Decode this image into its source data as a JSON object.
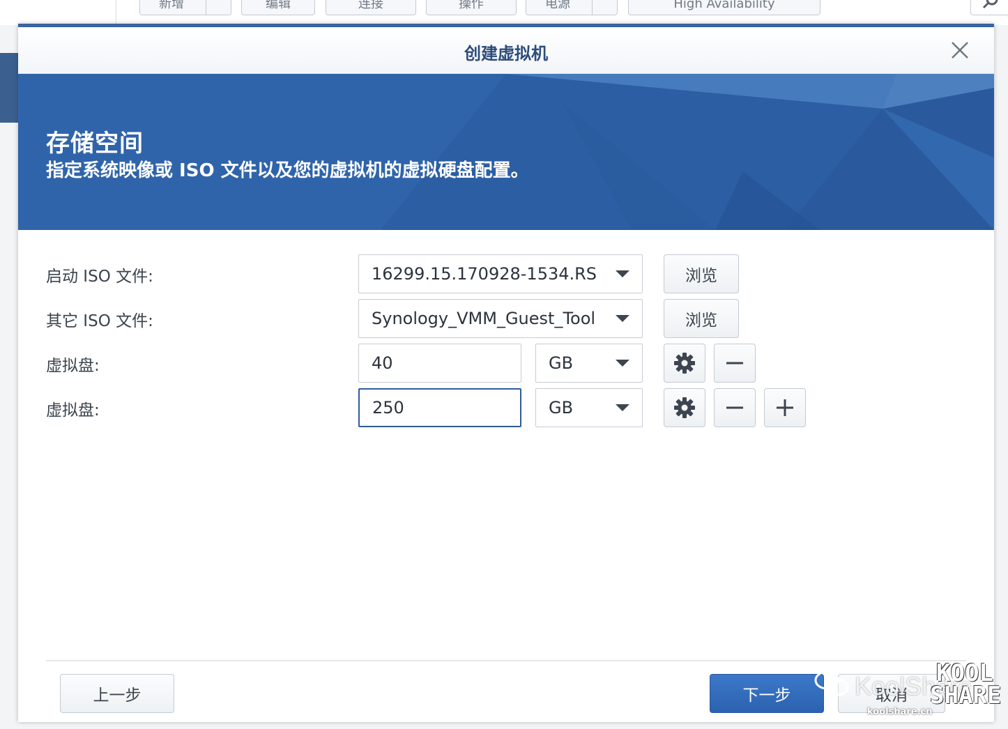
{
  "background_toolbar": {
    "buttons": [
      "新增",
      "编辑",
      "连接",
      "操作",
      "电源",
      "High Availability"
    ]
  },
  "dialog": {
    "title": "创建虚拟机",
    "banner": {
      "heading": "存储空间",
      "description": "指定系统映像或 ISO 文件以及您的虚拟机的虚拟硬盘配置。"
    },
    "form": {
      "boot_iso": {
        "label": "启动 ISO 文件:",
        "value": "16299.15.170928-1534.RS",
        "browse_label": "浏览"
      },
      "other_iso": {
        "label": "其它 ISO 文件:",
        "value": "Synology_VMM_Guest_Tool",
        "browse_label": "浏览"
      },
      "disks": [
        {
          "label": "虚拟盘:",
          "size": "40",
          "unit": "GB"
        },
        {
          "label": "虚拟盘:",
          "size": "250",
          "unit": "GB"
        }
      ]
    },
    "footer": {
      "back_label": "上一步",
      "next_label": "下一步",
      "cancel_label": "取消"
    }
  },
  "watermark": {
    "brand": "KoolShare",
    "url": "koolshare.cn",
    "logo_text": "KOOL SHARE"
  },
  "colors": {
    "accent": "#3a64a3",
    "banner": "#2f65ac",
    "primary_button": "#2b62b0"
  },
  "icons": [
    "close-icon",
    "dropdown-caret-icon",
    "gear-icon",
    "minus-icon",
    "plus-icon",
    "search-icon",
    "wechat-icon"
  ]
}
